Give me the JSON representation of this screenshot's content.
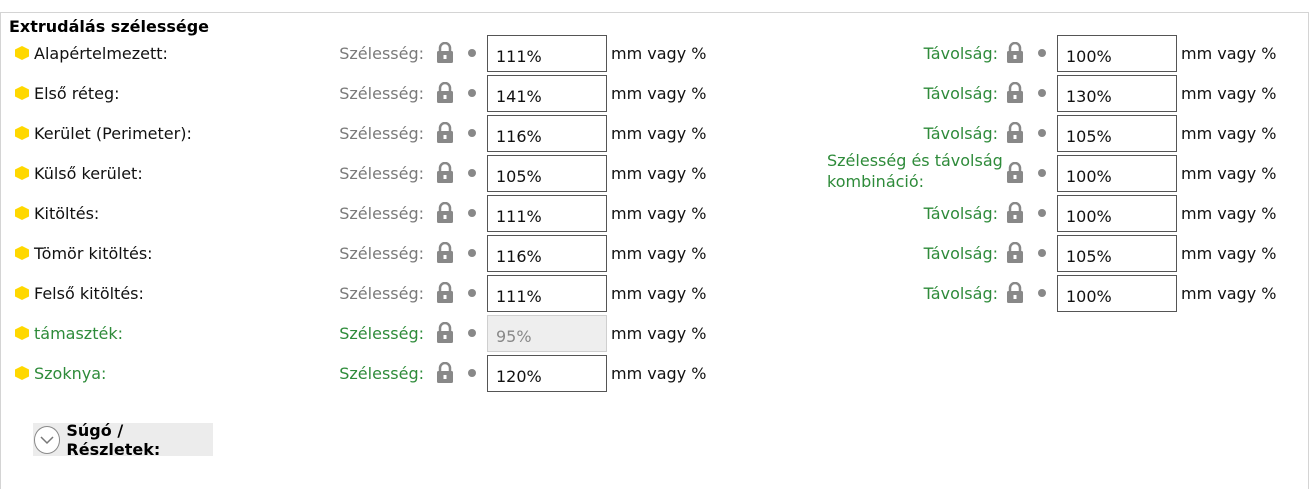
{
  "group_title": "Extrudálás szélessége",
  "width_label": "Szélesség:",
  "spacing_label": "Távolság:",
  "unit_label": "mm vagy %",
  "colors": {
    "bullet": "#ffd800",
    "advanced_text": "#2e8b3a",
    "icon_gray": "#888888"
  },
  "rows": [
    {
      "label": "Alapértelmezett:",
      "width": "111%",
      "spacing": "100%"
    },
    {
      "label": "Első réteg:",
      "width": "141%",
      "spacing": "130%"
    },
    {
      "label": "Kerület (Perimeter):",
      "width": "116%",
      "spacing": "105%"
    },
    {
      "label": "Külső kerület:",
      "width": "105%",
      "spacing": "100%",
      "spacing_label": "Szélesség és távolság kombináció:"
    },
    {
      "label": "Kitöltés:",
      "width": "111%",
      "spacing": "100%"
    },
    {
      "label": "Tömör kitöltés:",
      "width": "116%",
      "spacing": "105%"
    },
    {
      "label": "Felső kitöltés:",
      "width": "111%",
      "spacing": "100%"
    },
    {
      "label": "támaszték:",
      "width": "95%"
    },
    {
      "label": "Szoknya:",
      "width": "120%"
    }
  ],
  "help": {
    "label": "Súgó / Részletek:",
    "icon": "chevron-down-icon"
  }
}
